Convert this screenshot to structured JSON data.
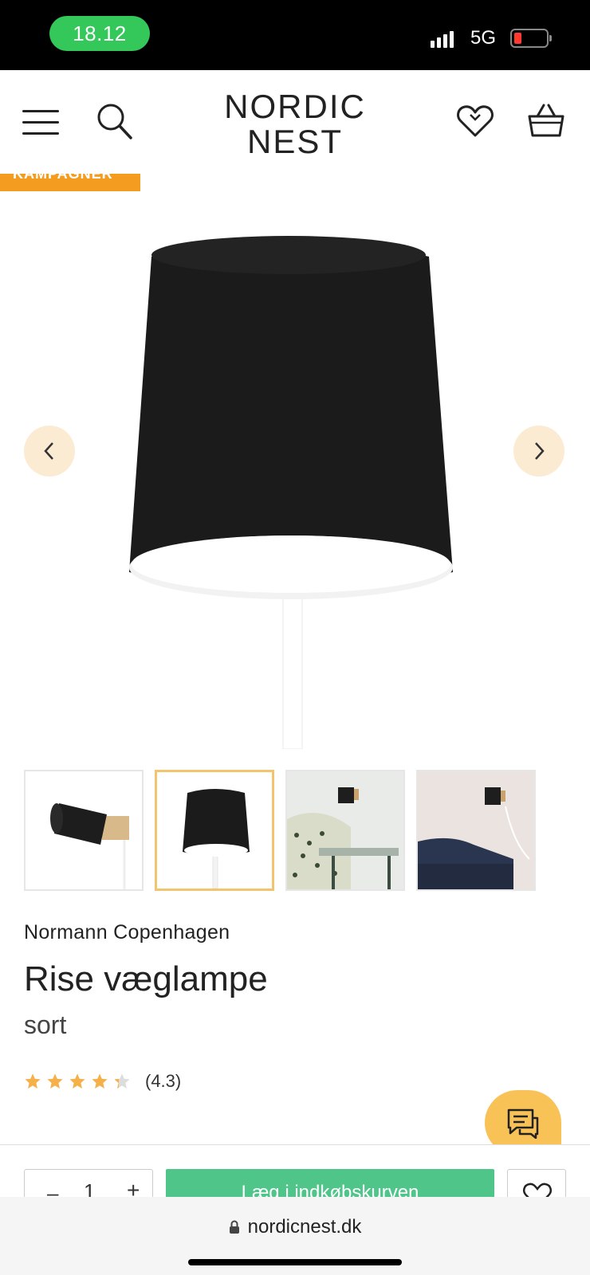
{
  "status_bar": {
    "time": "18.12",
    "network": "5G",
    "battery_color": "#ff3b30"
  },
  "header": {
    "logo_line1": "NORDIC",
    "logo_line2": "NEST",
    "campaign_label": "KAMPAGNER"
  },
  "gallery": {
    "thumbnails": [
      {
        "label": "wall-lamp-side-view",
        "selected": false
      },
      {
        "label": "wall-lamp-front-view",
        "selected": true
      },
      {
        "label": "lamp-in-bedroom",
        "selected": false
      },
      {
        "label": "lamp-above-sofa",
        "selected": false
      }
    ],
    "selected_index": 1
  },
  "product": {
    "brand": "Normann Copenhagen",
    "name": "Rise væglampe",
    "variant": "sort",
    "rating": 4.3,
    "rating_text": "(4.3)",
    "max_stars": 5
  },
  "purchase": {
    "quantity": "1",
    "minus_label": "–",
    "plus_label": "+",
    "add_to_cart_label": "Læg i indkøbskurven"
  },
  "browser": {
    "url": "nordicnest.dk"
  },
  "colors": {
    "accent_orange": "#f39c1f",
    "star_color": "#f5b04a",
    "cta_green": "#4fc58a",
    "chat_yellow": "#f8c257",
    "arrow_bg": "#fcebd3"
  }
}
